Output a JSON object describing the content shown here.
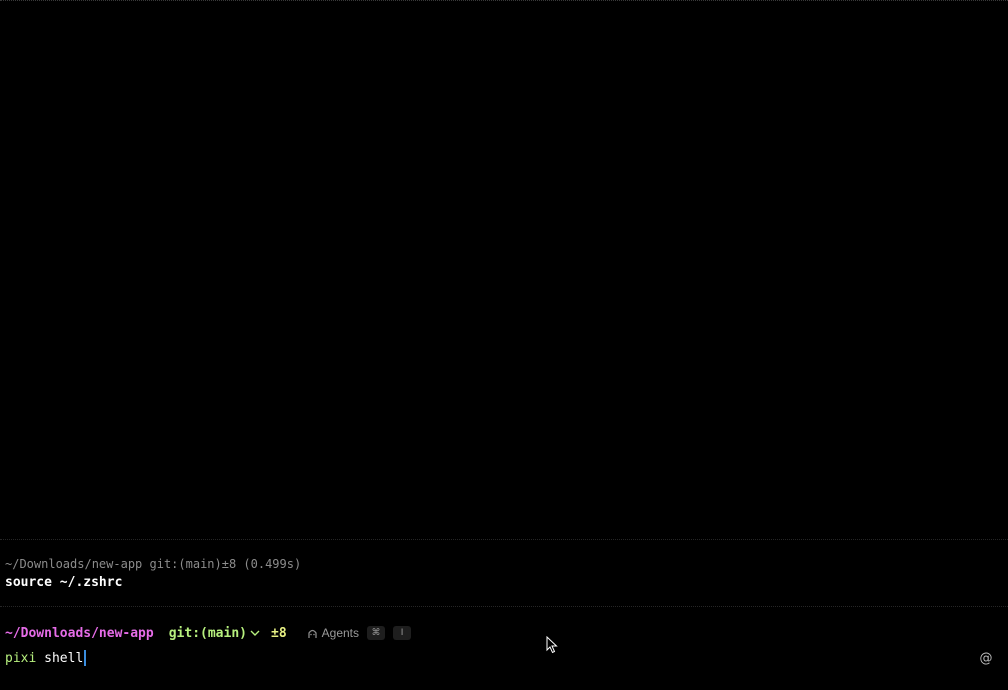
{
  "previous_block": {
    "meta": "~/Downloads/new-app git:(main)±8 (0.499s)",
    "command": "source ~/.zshrc"
  },
  "prompt": {
    "path": "~/Downloads/new-app",
    "git": "git:(main)",
    "dirty": "±8",
    "agents_label": "Agents",
    "agents_key": "⌘",
    "agents_key2": "I"
  },
  "input": {
    "command": "pixi",
    "args": " shell"
  },
  "at_button": "@",
  "icons": {
    "agents": "robot-icon",
    "chevron": "chevron-down-icon",
    "cursor": "mouse-pointer-icon"
  },
  "colors": {
    "background": "#000000",
    "path": "#e66ce8",
    "git": "#b7f07e",
    "dirty": "#e7f083",
    "caret": "#3a8dde"
  }
}
